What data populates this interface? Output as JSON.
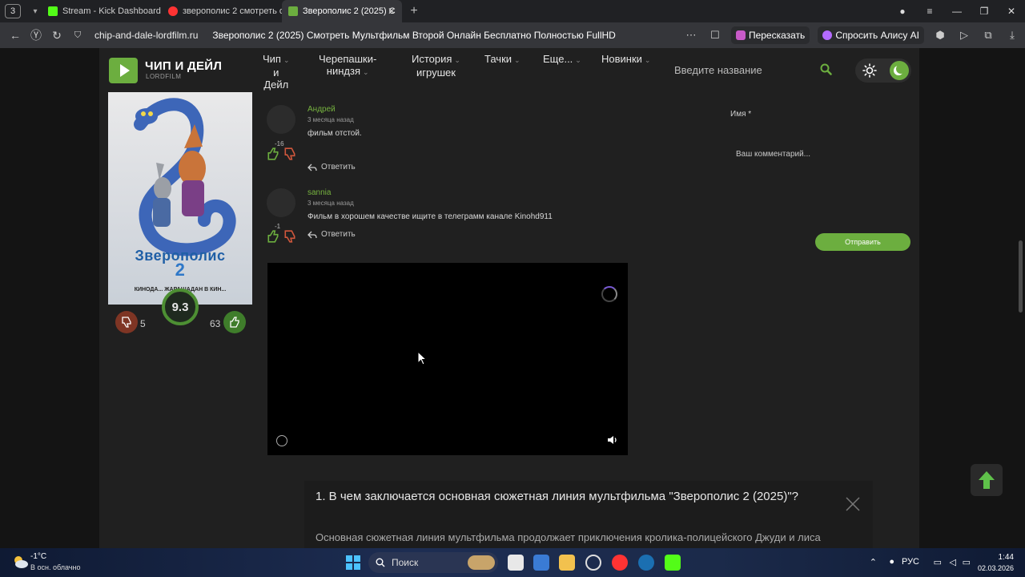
{
  "browser": {
    "tab_counter": "3",
    "tabs": [
      {
        "label": "Stream - Kick Dashboard",
        "color": "#53fc18"
      },
      {
        "label": "зверополис 2 смотреть о",
        "color": "#f33"
      },
      {
        "label": "Зверополис 2 (2025) С",
        "color": "#6cae3f"
      }
    ],
    "domain": "chip-and-dale-lordfilm.ru",
    "page_title": "Зверополис 2 (2025) Смотреть Мультфильм Второй Онлайн Бесплатно Полностью FullHD",
    "retell_label": "Пересказать",
    "alice_label": "Спросить Алису AI"
  },
  "site": {
    "logo_title": "ЧИП И ДЕЙЛ",
    "logo_subtitle": "LORDFILM",
    "menu": [
      {
        "line1": "Чип",
        "line2": "и",
        "line3": "Дейл"
      },
      {
        "line1": "Черепашки-",
        "line2": "ниндзя",
        "line3": ""
      },
      {
        "line1": "История",
        "line2": "игрушек",
        "line3": ""
      },
      {
        "line1": "Тачки",
        "line2": "",
        "line3": ""
      },
      {
        "line1": "Еще...",
        "line2": "",
        "line3": ""
      },
      {
        "line1": "Новинки",
        "line2": "",
        "line3": ""
      }
    ],
    "search_placeholder": "Введите название",
    "accent_color": "#6cae3f"
  },
  "movie": {
    "poster_title": "Зверополис",
    "poster_number": "2",
    "poster_tag": "КИНОДА... ЖАРАШАДАН В КИН...",
    "rating": "9.3",
    "dislikes": "5",
    "likes": "63"
  },
  "comments": [
    {
      "author": "Андрей",
      "time": "3 месяца назад",
      "text": "фильм отстой.",
      "score": "-16",
      "reply_label": "Ответить"
    },
    {
      "author": "sannia",
      "time": "3 месяца назад",
      "text": "Фильм в хорошем качестве ищите в телеграмм канале Kinohd911",
      "score": "-1",
      "reply_label": "Ответить"
    }
  ],
  "comment_form": {
    "name_label": "Имя *",
    "comment_placeholder": "Ваш комментарий...",
    "submit_label": "Отправить"
  },
  "faq": {
    "question": "1. В чем заключается основная сюжетная линия мультфильма \"Зверополис 2 (2025)\"?",
    "answer": "Основная сюжетная линия мультфильма продолжает приключения кролика-полицейского Джуди и лиса"
  },
  "taskbar": {
    "weather_temp": "-1°C",
    "weather_desc": "В осн. облачно",
    "search_label": "Поиск",
    "language": "РУС",
    "time": "1:44",
    "date": "02.03.2026"
  }
}
